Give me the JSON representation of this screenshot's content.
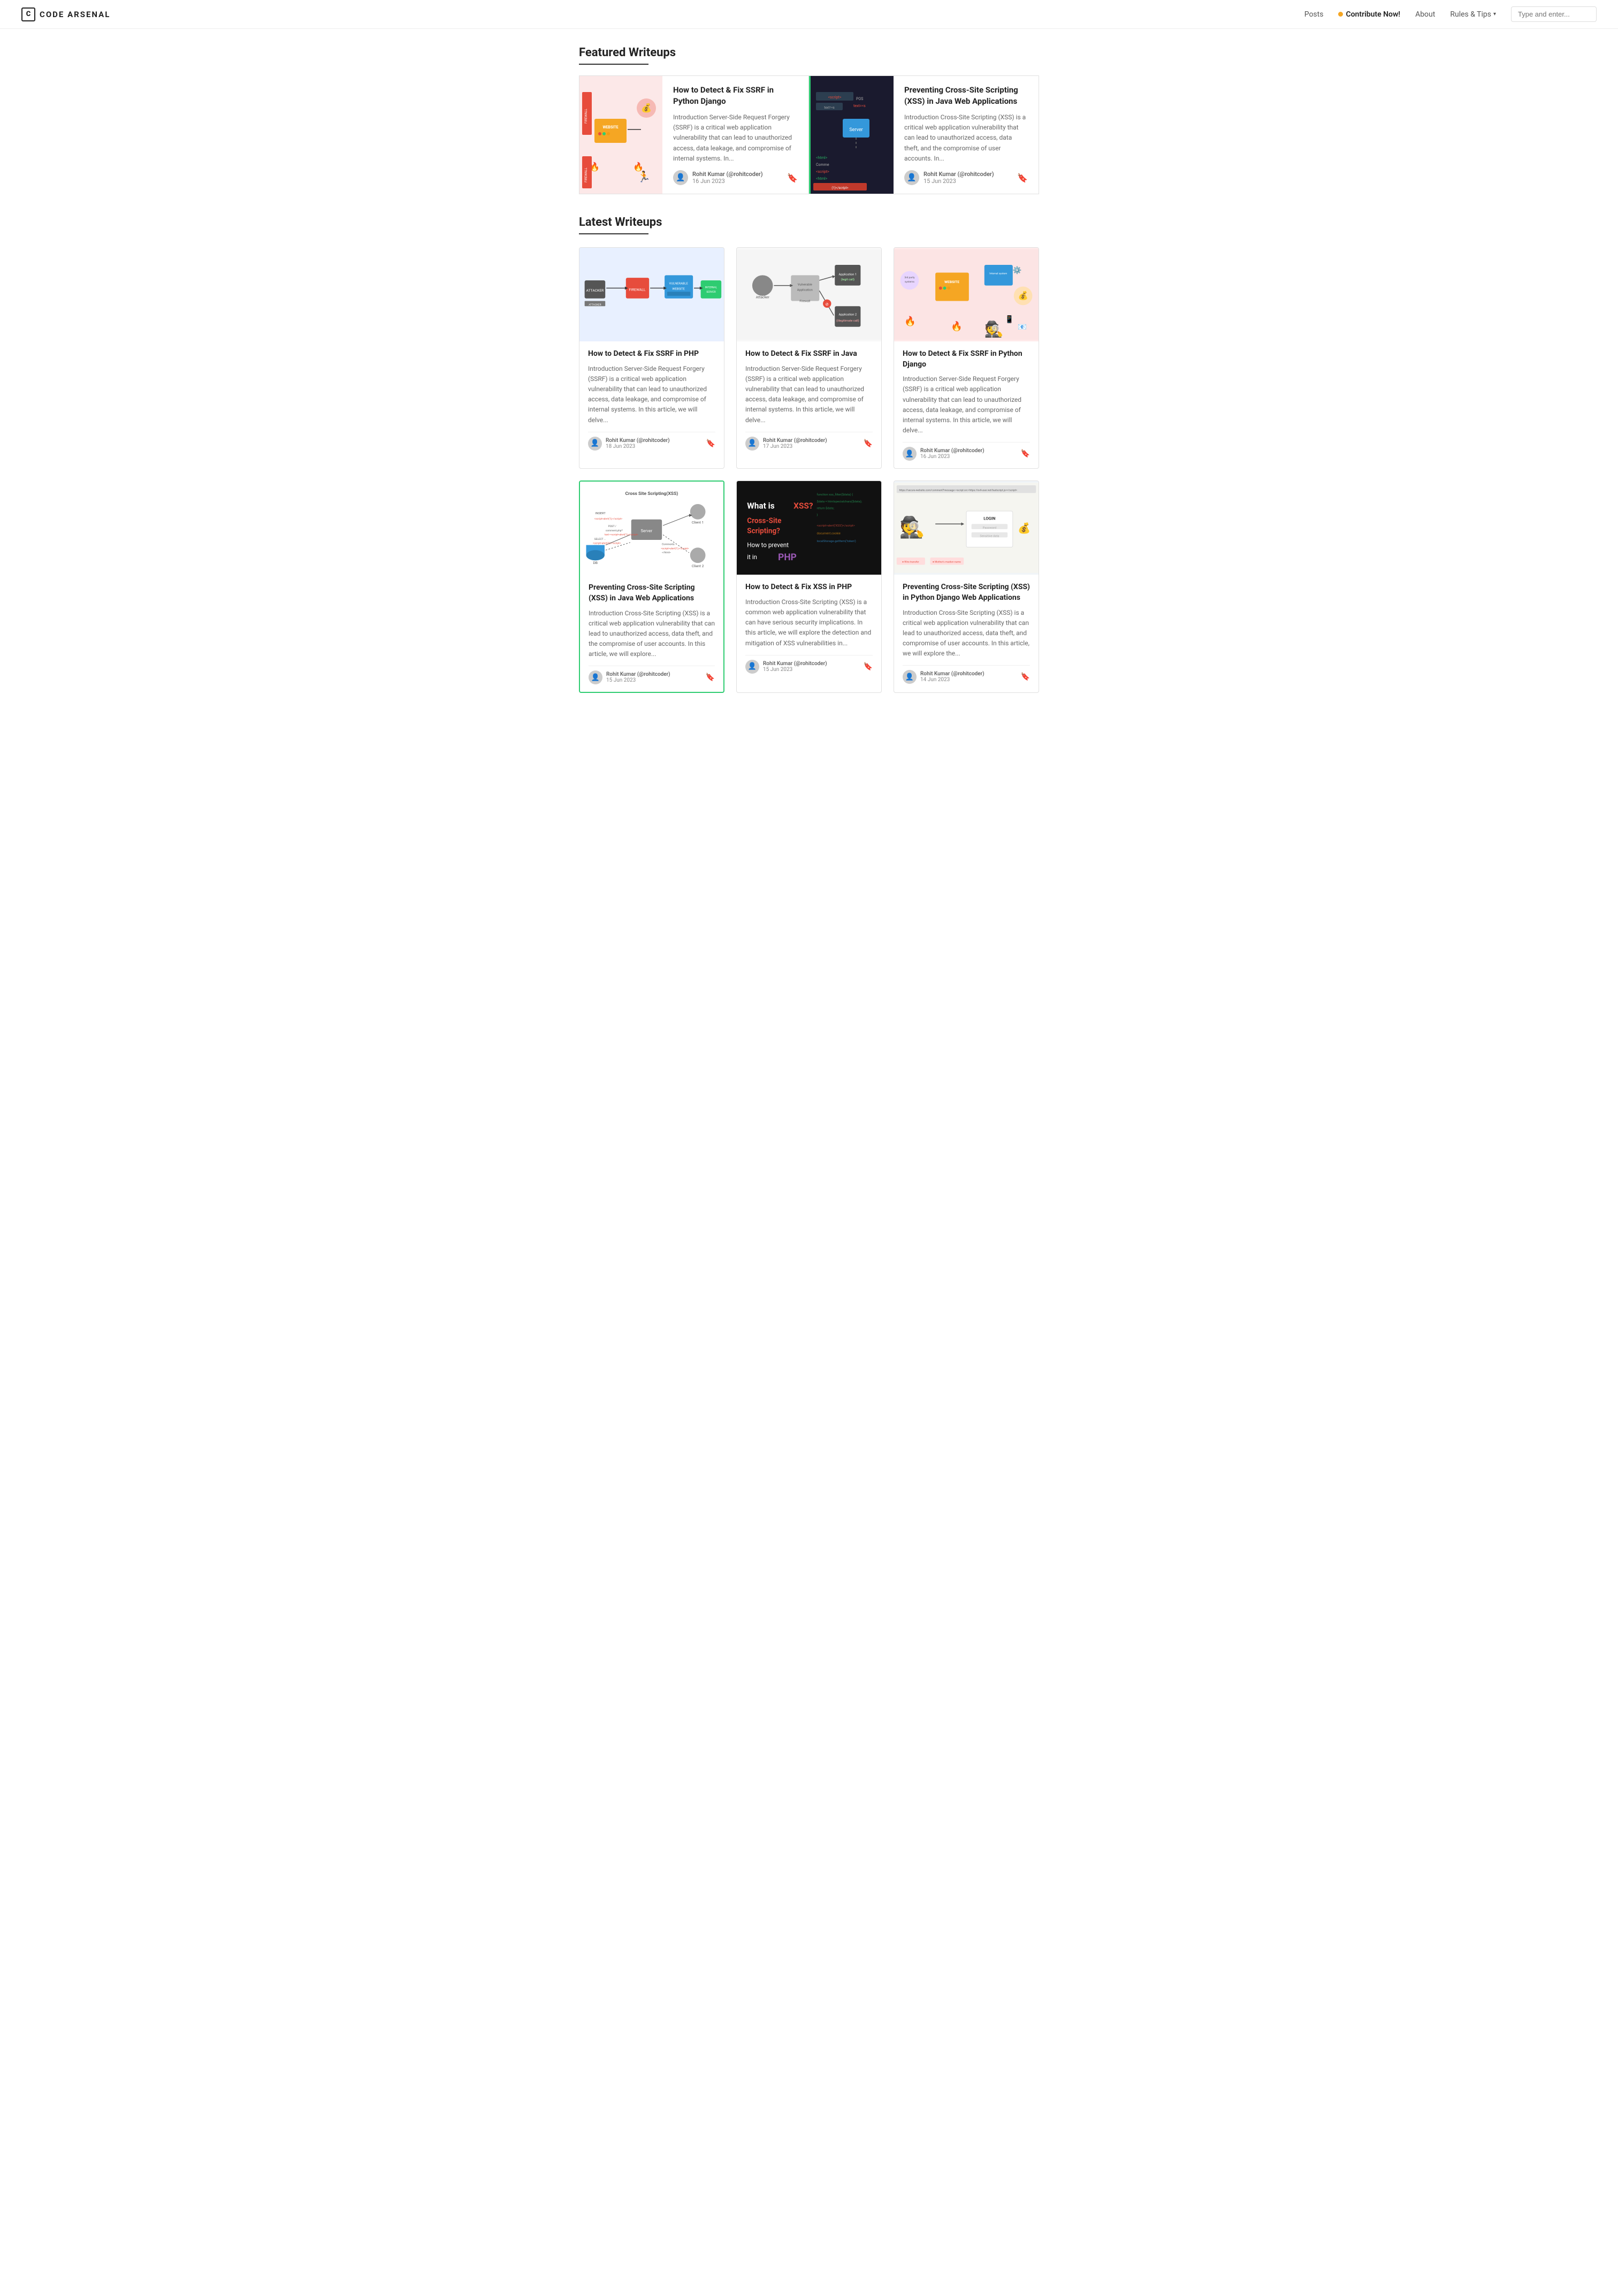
{
  "header": {
    "logo_icon": "C",
    "logo_text": "CODE ARSENAL",
    "nav": {
      "posts": "Posts",
      "contribute": "Contribute Now!",
      "about": "About",
      "rules_tips": "Rules & Tips",
      "search_placeholder": "Type and enter..."
    }
  },
  "featured": {
    "section_title": "Featured Writeups",
    "cards": [
      {
        "title": "How to Detect & Fix SSRF in Python Django",
        "desc": "Introduction Server-Side Request Forgery (SSRF) is a critical web application vulnerability that can lead to unauthorized access, data leakage, and compromise of internal systems. In...",
        "author_name": "Rohit Kumar (@rohitcoder)",
        "date": "16 Jun 2023",
        "image_theme": "ssrf_pink"
      },
      {
        "title": "Preventing Cross-Site Scripting (XSS) in Java Web Applications",
        "desc": "Introduction Cross-Site Scripting (XSS) is a critical web application vulnerability that can lead to unauthorized access, data theft, and the compromise of user accounts. In...",
        "author_name": "Rohit Kumar (@rohitcoder)",
        "date": "15 Jun 2023",
        "image_theme": "xss_dark",
        "green_border": true
      }
    ]
  },
  "latest": {
    "section_title": "Latest Writeups",
    "articles": [
      {
        "title": "How to Detect & Fix SSRF in PHP",
        "desc": "Introduction Server-Side Request Forgery (SSRF) is a critical web application vulnerability that can lead to unauthorized access, data leakage, and compromise of internal systems. In this article, we will delve...",
        "author_name": "Rohit Kumar (@rohitcoder)",
        "date": "18 Jun 2023",
        "image_theme": "ssrf_diagram"
      },
      {
        "title": "How to Detect & Fix SSRF in Java",
        "desc": "Introduction Server-Side Request Forgery (SSRF) is a critical web application vulnerability that can lead to unauthorized access, data leakage, and compromise of internal systems. In this article, we will delve...",
        "author_name": "Rohit Kumar (@rohitcoder)",
        "date": "17 Jun 2023",
        "image_theme": "ssrf_firewall"
      },
      {
        "title": "How to Detect & Fix SSRF in Python Django",
        "desc": "Introduction Server-Side Request Forgery (SSRF) is a critical web application vulnerability that can lead to unauthorized access, data leakage, and compromise of internal systems. In this article, we will delve...",
        "author_name": "Rohit Kumar (@rohitcoder)",
        "date": "16 Jun 2023",
        "image_theme": "ssrf_hacker"
      },
      {
        "title": "Preventing Cross-Site Scripting (XSS) in Java Web Applications",
        "desc": "Introduction Cross-Site Scripting (XSS) is a critical web application vulnerability that can lead to unauthorized access, data theft, and the compromise of user accounts. In this article, we will explore...",
        "author_name": "Rohit Kumar (@rohitcoder)",
        "date": "15 Jun 2023",
        "image_theme": "xss_diagram",
        "green_border": true
      },
      {
        "title": "How to Detect & Fix XSS in PHP",
        "desc": "Introduction Cross-Site Scripting (XSS) is a common web application vulnerability that can have serious security implications. In this article, we will explore the detection and mitigation of XSS vulnerabilities in...",
        "author_name": "Rohit Kumar (@rohitcoder)",
        "date": "15 Jun 2023",
        "image_theme": "xss_dark2"
      },
      {
        "title": "Preventing Cross-Site Scripting (XSS) in Python Django Web Applications",
        "desc": "Introduction Cross-Site Scripting (XSS) is a critical web application vulnerability that can lead to unauthorized access, data theft, and compromise of user accounts. In this article, we will explore the...",
        "author_name": "Rohit Kumar (@rohitcoder)",
        "date": "14 Jun 2023",
        "image_theme": "xss_login"
      }
    ]
  },
  "icons": {
    "bookmark": "🔖",
    "dropdown_arrow": "▾"
  }
}
